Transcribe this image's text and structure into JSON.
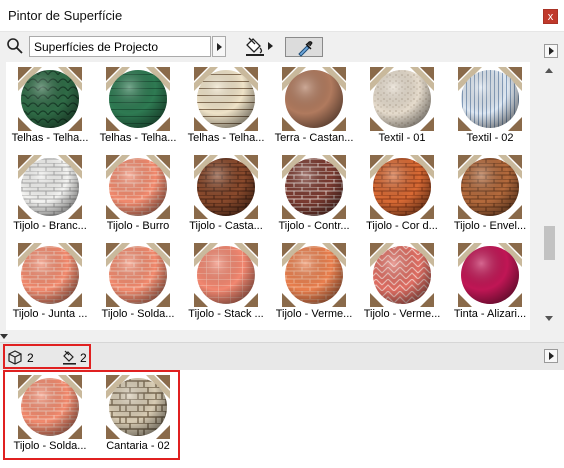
{
  "window": {
    "title": "Pintor de Superfície",
    "close_label": "x"
  },
  "toolbar": {
    "source_select_value": "Superfícies de Projecto"
  },
  "materials": [
    {
      "label": "Telhas - Telha...",
      "swatch": "tile-green-scale"
    },
    {
      "label": "Telhas - Telha...",
      "swatch": "tile-green-stripe"
    },
    {
      "label": "Telhas - Telha...",
      "swatch": "cream-stripe"
    },
    {
      "label": "Terra - Castan...",
      "swatch": "earth-brown"
    },
    {
      "label": "Textil - 01",
      "swatch": "textile-beige"
    },
    {
      "label": "Textil - 02",
      "swatch": "textile-striped-blue"
    },
    {
      "label": "Tijolo - Branc...",
      "swatch": "brick-white"
    },
    {
      "label": "Tijolo - Burro",
      "swatch": "brick-salmon"
    },
    {
      "label": "Tijolo - Casta...",
      "swatch": "brick-brown"
    },
    {
      "label": "Tijolo - Contr...",
      "swatch": "brick-dark-red"
    },
    {
      "label": "Tijolo - Cor d...",
      "swatch": "brick-orange"
    },
    {
      "label": "Tijolo - Envel...",
      "swatch": "brick-aged"
    },
    {
      "label": "Tijolo - Junta ...",
      "swatch": "brick-salmon"
    },
    {
      "label": "Tijolo - Solda...",
      "swatch": "brick-salmon"
    },
    {
      "label": "Tijolo - Stack ...",
      "swatch": "brick-stack"
    },
    {
      "label": "Tijolo - Verme...",
      "swatch": "brick-orange-red"
    },
    {
      "label": "Tijolo - Verme...",
      "swatch": "brick-herringbone"
    },
    {
      "label": "Tinta - Alizari...",
      "swatch": "paint-crimson"
    }
  ],
  "status": {
    "model_count": "2",
    "painted_count": "2"
  },
  "used_surfaces": [
    {
      "label": "Tijolo - Solda...",
      "swatch": "brick-salmon"
    },
    {
      "label": "Cantaria - 02",
      "swatch": "stone-masonry"
    }
  ],
  "colors": {
    "highlight": "#e02020",
    "close_button": "#c0392b"
  }
}
